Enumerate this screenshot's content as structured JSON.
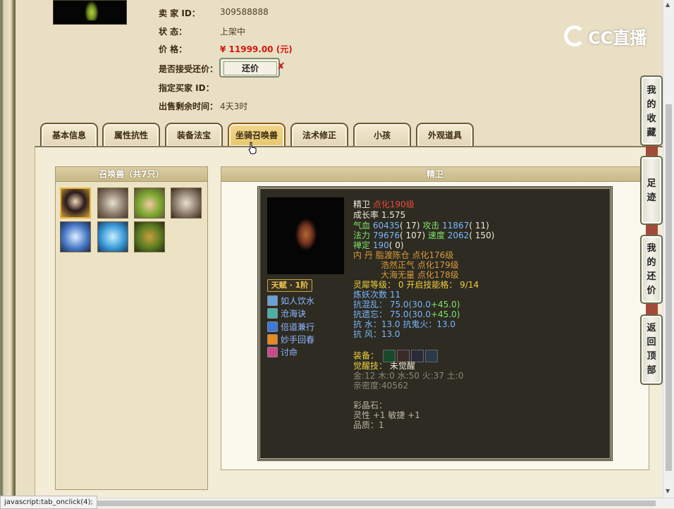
{
  "seller": {
    "seller_label": "卖 家 ID：",
    "seller_value": "309588888",
    "status_label": "状 态：",
    "status_value": "上架中",
    "price_label": "价 格：",
    "price_value": "¥ 11999.00 (元)",
    "accept_label": "是否接受还价：",
    "haggle_button": "还价",
    "buyer_label": "指定买家 ID：",
    "time_label": "出售剩余时间：",
    "time_value": "4天3时"
  },
  "logo": {
    "text": "CC直播"
  },
  "tabs": [
    "基本信息",
    "属性抗性",
    "装备法宝",
    "坐骑召唤兽",
    "法术修正",
    "小孩",
    "外观道具"
  ],
  "active_tab": "坐骑召唤兽",
  "pets_panel": {
    "title": "召唤兽（共7只）",
    "pets": [
      {
        "icon": "girl-portrait-icon",
        "selected": true
      },
      {
        "icon": "rabbit-icon",
        "selected": false
      },
      {
        "icon": "goblin-icon",
        "selected": false
      },
      {
        "icon": "rabbit-icon",
        "selected": false
      },
      {
        "icon": "ice-spirit-icon",
        "selected": false
      },
      {
        "icon": "ice-warrior-icon",
        "selected": false
      },
      {
        "icon": "tree-demon-icon",
        "selected": false
      }
    ]
  },
  "detail": {
    "title": "精卫",
    "talent": "天赋 · 1阶",
    "skills": [
      {
        "name": "如人饮水",
        "icon": "water-skill-icon"
      },
      {
        "name": "沧海诀",
        "icon": "sea-skill-icon"
      },
      {
        "name": "倍道兼行",
        "icon": "speed-skill-icon"
      },
      {
        "name": "妙手回春",
        "icon": "heal-skill-icon"
      },
      {
        "name": "讨命",
        "icon": "death-skill-icon"
      }
    ],
    "name": "精卫",
    "rank": "点化190级",
    "growth_label": "成长率",
    "growth": "1.575",
    "hp_label": "气血",
    "hp": "60435",
    "hp_pt": "17",
    "atk_label": "攻击",
    "atk": "11867",
    "atk_pt": "11",
    "mp_label": "法力",
    "mp": "79676",
    "mp_pt": "107",
    "spd_label": "速度",
    "spd": "2062",
    "spd_pt": "150",
    "def_label": "禅定",
    "def": "190",
    "def_pt": "0",
    "neidan_label": "内 丹",
    "neidan": [
      "脂渡陈仓 点化176级",
      "浩然正气 点化179级",
      "大海无量 点化178级"
    ],
    "spirit_label": "灵犀等级：",
    "spirit": "0",
    "skills_open_label": "开启技能格：",
    "skills_open": "9/14",
    "refine_label": "炼妖次数",
    "refine": "11",
    "res1_label": "抗混乱：",
    "res1_base": "75.0(30.0",
    "res1_add": "+45.0)",
    "res2_label": "抗遗忘：",
    "res2_base": "75.0(30.0",
    "res2_add": "+45.0)",
    "res3": "抗 水：13.0 抗鬼火：13.0",
    "res4": "抗 风：13.0",
    "equip_label": "装备：",
    "equip_icons": [
      "jade-ring-icon",
      "sword-icon",
      "amulet-icon",
      "crown-icon"
    ],
    "awaken_label": "觉醒技：",
    "awaken_value": "未觉醒",
    "elements": "金:12 木:0 水:50 火:37 土:0",
    "intimacy": "亲密度:40562",
    "gem_label": "彩晶石：",
    "gem_bonus": "灵性 +1 敏捷 +1",
    "quality": "品质：1"
  },
  "sidebar": [
    "我的收藏",
    "足迹",
    "我的还价",
    "返回顶部"
  ],
  "statusbar": "javascript:tab_onclick(4);"
}
